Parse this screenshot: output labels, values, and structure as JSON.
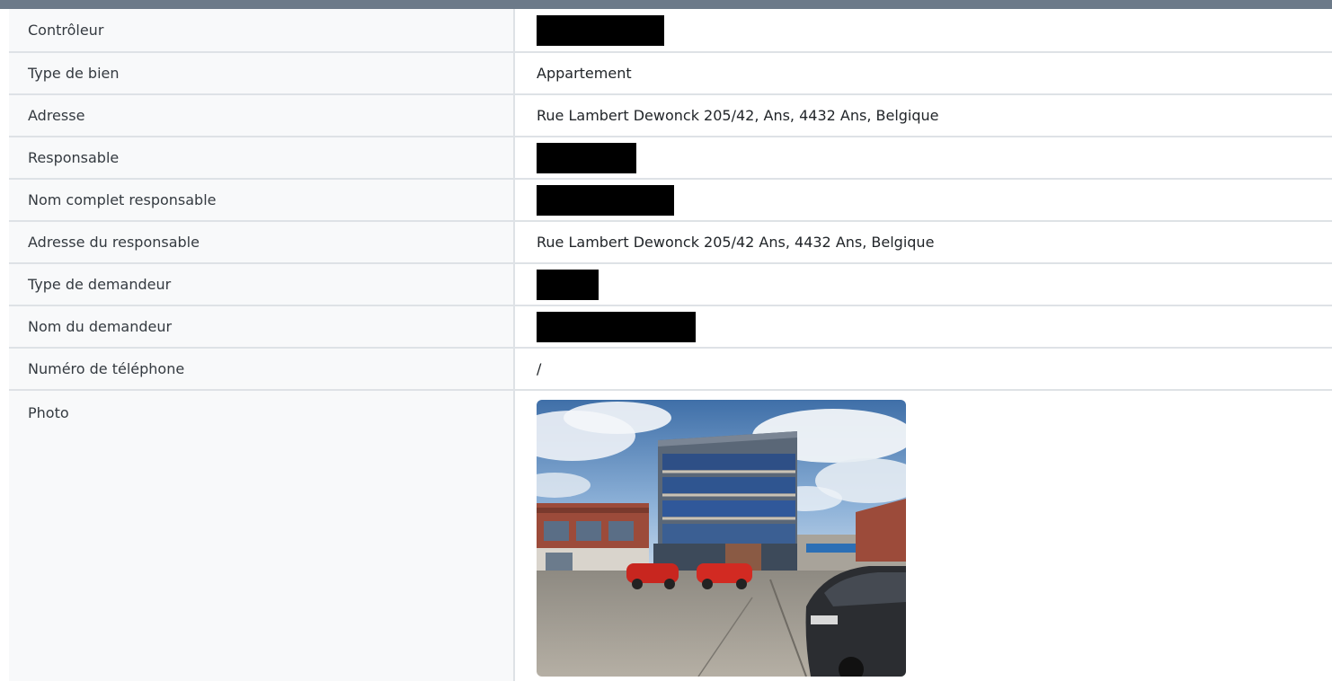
{
  "details": {
    "controleur_label": "Contrôleur",
    "type_bien_label": "Type de bien",
    "type_bien_value": "Appartement",
    "adresse_label": "Adresse",
    "adresse_value": "Rue Lambert Dewonck 205/42, Ans, 4432 Ans, Belgique",
    "responsable_label": "Responsable",
    "nom_complet_label": "Nom complet responsable",
    "adresse_resp_label": "Adresse du responsable",
    "adresse_resp_value": "Rue Lambert Dewonck 205/42 Ans, 4432 Ans, Belgique",
    "type_demandeur_label": "Type de demandeur",
    "nom_demandeur_label": "Nom du demandeur",
    "telephone_label": "Numéro de téléphone",
    "telephone_value": "/",
    "photo_label": "Photo"
  },
  "colors": {
    "header_bar": "#6c7a89",
    "label_bg": "#f8f9fa",
    "border": "#dee2e6",
    "redaction": "#000000"
  }
}
